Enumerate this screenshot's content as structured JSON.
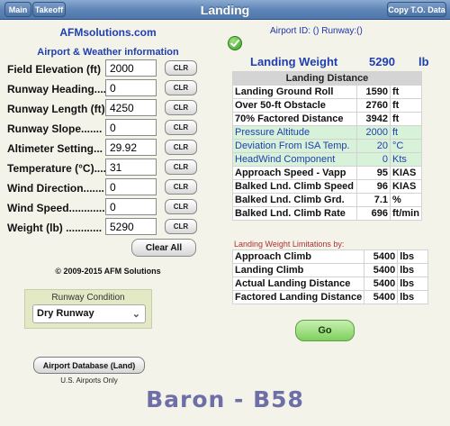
{
  "nav": {
    "main_label": "Main",
    "takeoff_label": "Takeoff",
    "title": "Landing",
    "copy_label": "Copy T.O. Data"
  },
  "left": {
    "site": "AFMsolutions.com",
    "section_title": "Airport & Weather information",
    "clr_label": "CLR",
    "fields": [
      {
        "label": "Field Elevation (ft)",
        "value": "2000"
      },
      {
        "label": "Runway Heading....",
        "value": "0"
      },
      {
        "label": "Runway Length (ft)",
        "value": "4250"
      },
      {
        "label": "Runway Slope.......",
        "value": "0"
      },
      {
        "label": "Altimeter Setting...",
        "value": "29.92"
      },
      {
        "label": "Temperature (°C)....",
        "value": "31"
      },
      {
        "label": "Wind Direction.......",
        "value": "0"
      },
      {
        "label": "Wind Speed............",
        "value": "0"
      },
      {
        "label": "Weight (lb) ............",
        "value": "5290"
      }
    ],
    "clear_all_label": "Clear All",
    "copyright": "© 2009-2015 AFM Solutions",
    "runway_condition_label": "Runway Condition",
    "runway_condition_value": "Dry Runway",
    "db_button_label": "Airport Database (Land)",
    "db_note": "U.S. Airports Only"
  },
  "right": {
    "airport_id": "Airport ID: () Runway:()",
    "landing_weight_label": "Landing Weight",
    "landing_weight_value": "5290",
    "landing_weight_unit": "lb",
    "distance_header": "Landing Distance",
    "rows": [
      {
        "label": "Landing Ground Roll",
        "value": "1590",
        "unit": "ft",
        "blue": false
      },
      {
        "label": "Over 50-ft Obstacle",
        "value": "2760",
        "unit": "ft",
        "blue": false
      },
      {
        "label": "70% Factored Distance",
        "value": "3942",
        "unit": "ft",
        "blue": false
      },
      {
        "label": "Pressure Altitude",
        "value": "2000",
        "unit": "ft",
        "blue": true
      },
      {
        "label": "Deviation From ISA Temp.",
        "value": "20",
        "unit": "°C",
        "blue": true
      },
      {
        "label": "HeadWind Component",
        "value": "0",
        "unit": "Kts",
        "blue": true
      },
      {
        "label": "Approach Speed - Vapp",
        "value": "95",
        "unit": "KIAS",
        "blue": false
      },
      {
        "label": "Balked Lnd. Climb Speed",
        "value": "96",
        "unit": "KIAS",
        "blue": false
      },
      {
        "label": "Balked Lnd. Climb Grd.",
        "value": "7.1",
        "unit": "%",
        "blue": false
      },
      {
        "label": "Balked Lnd. Climb Rate",
        "value": "696",
        "unit": "ft/min",
        "blue": false
      }
    ],
    "limits_title": "Landing Weight Limitations by:",
    "limits": [
      {
        "label": "Approach Climb",
        "value": "5400",
        "unit": "lbs"
      },
      {
        "label": "Landing Climb",
        "value": "5400",
        "unit": "lbs"
      },
      {
        "label": "Actual Landing Distance",
        "value": "5400",
        "unit": "lbs"
      },
      {
        "label": "Factored Landing Distance",
        "value": "5400",
        "unit": "lbs"
      }
    ],
    "go_label": "Go"
  },
  "aircraft": "Baron - B58"
}
